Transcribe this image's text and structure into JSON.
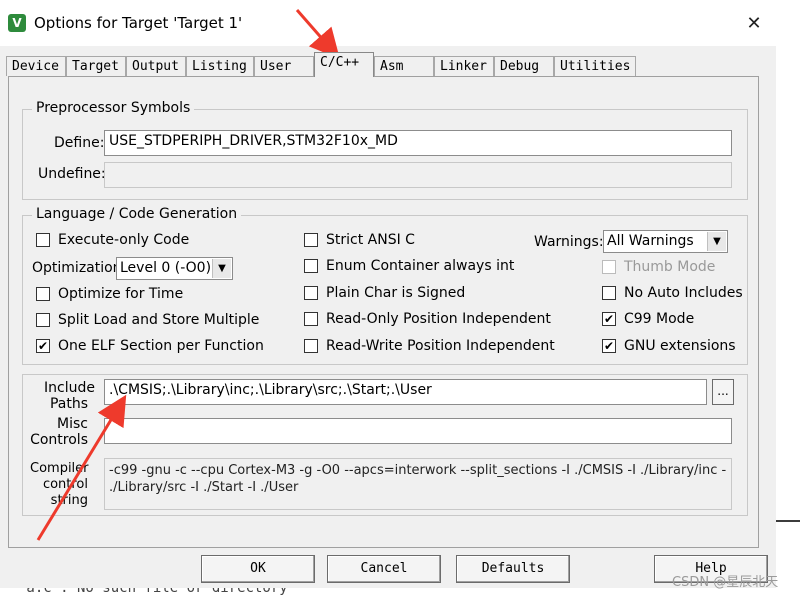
{
  "window": {
    "title": "Options for Target 'Target 1'",
    "close_symbol": "✕",
    "app_icon_glyph": "V"
  },
  "tabs": [
    {
      "label": "Device"
    },
    {
      "label": "Target"
    },
    {
      "label": "Output"
    },
    {
      "label": "Listing"
    },
    {
      "label": "User"
    },
    {
      "label": "C/C++",
      "active": true
    },
    {
      "label": "Asm"
    },
    {
      "label": "Linker"
    },
    {
      "label": "Debug"
    },
    {
      "label": "Utilities"
    }
  ],
  "preprocessor": {
    "title": "Preprocessor Symbols",
    "define_label": "Define:",
    "define_value": "USE_STDPERIPH_DRIVER,STM32F10x_MD",
    "undefine_label": "Undefine:",
    "undefine_value": ""
  },
  "language": {
    "title": "Language / Code Generation",
    "optimization_label": "Optimization:",
    "optimization_value": "Level 0 (-O0)",
    "warnings_label": "Warnings:",
    "warnings_value": "All Warnings",
    "col1": [
      {
        "label": "Execute-only Code",
        "checked": false
      },
      {
        "label": "Optimize for Time",
        "checked": false
      },
      {
        "label": "Split Load and Store Multiple",
        "checked": false
      },
      {
        "label": "One ELF Section per Function",
        "checked": true
      }
    ],
    "col2": [
      {
        "label": "Strict ANSI C",
        "checked": false
      },
      {
        "label": "Enum Container always int",
        "checked": false
      },
      {
        "label": "Plain Char is Signed",
        "checked": false
      },
      {
        "label": "Read-Only Position Independent",
        "checked": false
      },
      {
        "label": "Read-Write Position Independent",
        "checked": false
      }
    ],
    "col3": [
      {
        "label": "Thumb Mode",
        "checked": false,
        "disabled": true
      },
      {
        "label": "No Auto Includes",
        "checked": false
      },
      {
        "label": "C99 Mode",
        "checked": true
      },
      {
        "label": "GNU extensions",
        "checked": true
      }
    ]
  },
  "paths": {
    "include_label_1": "Include",
    "include_label_2": "Paths",
    "include_value": ".\\CMSIS;.\\Library\\inc;.\\Library\\src;.\\Start;.\\User",
    "browse_label": "...",
    "misc_label_1": "Misc",
    "misc_label_2": "Controls",
    "misc_value": "",
    "compiler_label_1": "Compiler",
    "compiler_label_2": "control",
    "compiler_label_3": "string",
    "compiler_line_1": "-c99 -gnu -c --cpu Cortex-M3 -g -O0 --apcs=interwork --split_sections -I ./CMSIS -I ./Library/inc -I",
    "compiler_line_2": "./Library/src -I ./Start -I ./User"
  },
  "buttons": {
    "ok": "OK",
    "cancel": "Cancel",
    "defaults": "Defaults",
    "help": "Help"
  },
  "background_text": "\"a.c\": No such file or directory",
  "watermark": "CSDN @星辰北天",
  "colors": {
    "annotation_arrow": "#ee3a2c",
    "check_color": "#000000"
  }
}
